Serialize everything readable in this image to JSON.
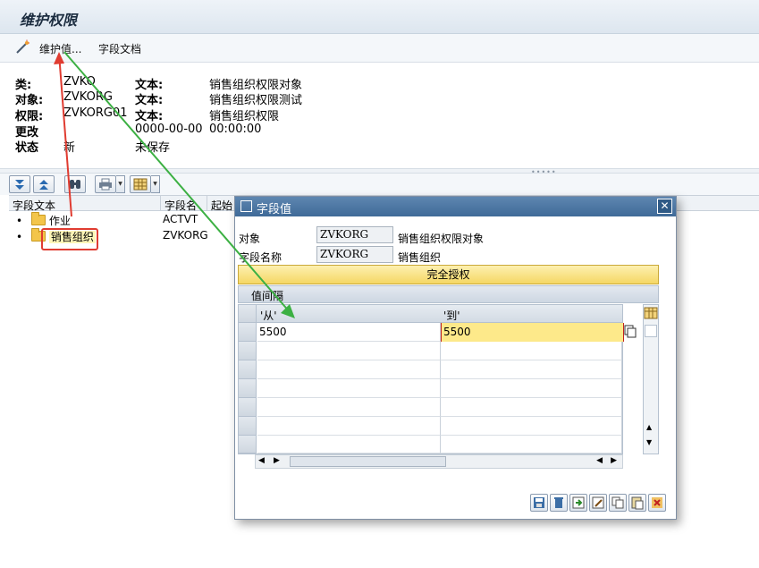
{
  "window": {
    "title": "维护权限"
  },
  "toolbar": {
    "maintain_values": "维护值...",
    "field_doc": "字段文档"
  },
  "info": {
    "rows": [
      {
        "label": "类:",
        "value": "ZVKO",
        "text_label": "文本:",
        "text": "销售组织权限对象"
      },
      {
        "label": "对象:",
        "value": "ZVKORG",
        "text_label": "文本:",
        "text": "销售组织权限测试"
      },
      {
        "label": "权限:",
        "value": "ZVKORG01",
        "text_label": "文本:",
        "text": "销售组织权限"
      },
      {
        "label": "更改",
        "value": "",
        "text_label": "0000-00-00",
        "text": "00:00:00"
      },
      {
        "label": "状态",
        "value": "新",
        "text_label": "未保存",
        "text": ""
      }
    ]
  },
  "tree": {
    "headers": {
      "field_text": "字段文本",
      "field_name": "字段名",
      "start": "起始"
    },
    "items": [
      {
        "label": "作业",
        "field": "ACTVT"
      },
      {
        "label": "销售组织",
        "field": "ZVKORG"
      }
    ]
  },
  "dialog": {
    "title": "字段值",
    "object_label": "对象",
    "object_value": "ZVKORG",
    "object_text": "销售组织权限对象",
    "fieldname_label": "字段名称",
    "fieldname_value": "ZVKORG",
    "fieldname_text": "销售组织",
    "full_auth": "完全授权",
    "grid_caption": "值间隔",
    "col_from": "'从'",
    "col_to": "'到'",
    "rows": [
      {
        "from": "5500",
        "to": "5500"
      }
    ]
  },
  "colors": {
    "arrow_red": "#e03c31",
    "arrow_green": "#3cb043",
    "highlight": "#fde98a"
  }
}
